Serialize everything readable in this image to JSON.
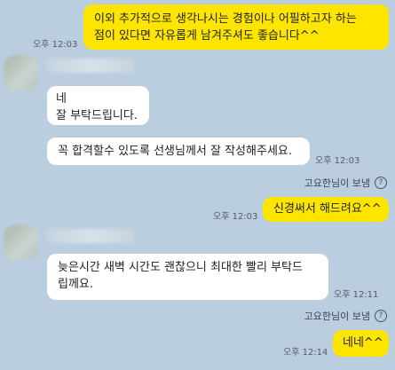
{
  "messages": [
    {
      "text": "이외 추가적으로 생각나시는 경험이나 어필하고자 하는\n점이 있다면 자유롭게 남겨주셔도 좋습니다^^",
      "time": "오후 12:03"
    },
    {
      "text": "네\n잘 부탁드립니다."
    },
    {
      "text": "꼭 합격할수 있도록 선생님께서 잘 작성해주세요.",
      "time": "오후 12:03"
    },
    {
      "text": "신경써서 해드려요^^",
      "time": "오후 12:03"
    },
    {
      "text": "늦은시간 새벽 시간도 괜찮으니 최대한 빨리 부탁드\n립께요.",
      "time": "오후 12:11"
    },
    {
      "text": "네네^^",
      "time": "오후 12:14"
    }
  ],
  "seen_notice": {
    "label": "고요한님이 보냄",
    "icon": "question-icon",
    "glyph": "?"
  }
}
